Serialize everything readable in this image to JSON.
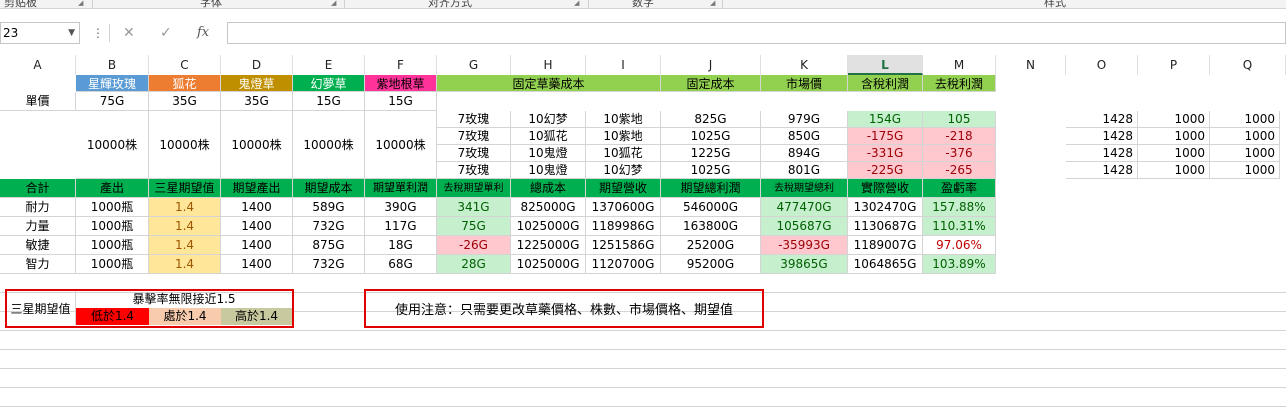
{
  "ribbon": {
    "groups": [
      "剪贴板",
      "字体",
      "对齐方式",
      "数字",
      "样式"
    ]
  },
  "formula_bar": {
    "name_box": "23",
    "fx": "fx",
    "cancel": "✕",
    "enter": "✓",
    "formula": ""
  },
  "columns": [
    "A",
    "B",
    "C",
    "D",
    "E",
    "F",
    "G",
    "H",
    "I",
    "J",
    "K",
    "L",
    "M",
    "N",
    "O",
    "P",
    "Q"
  ],
  "selected_column": "L",
  "rows": {
    "header": [
      "",
      "星輝玫瑰",
      "狐花",
      "鬼燈草",
      "幻夢草",
      "紫地根草",
      "固定草藥成本",
      "",
      "",
      "固定成本",
      "市場價",
      "含稅利潤",
      "去稅利潤"
    ],
    "unit_price": [
      "單價",
      "75G",
      "35G",
      "35G",
      "15G",
      "15G"
    ],
    "stock": "10000株",
    "recipes": [
      {
        "g": "7玫瑰",
        "h": "10幻梦",
        "i": "10紫地",
        "j": "825G",
        "k": "979G",
        "l": "154G",
        "m": "105",
        "o": "1428",
        "p": "1000",
        "q": "1000"
      },
      {
        "g": "7玫瑰",
        "h": "10狐花",
        "i": "10紫地",
        "j": "1025G",
        "k": "850G",
        "l": "-175G",
        "m": "-218",
        "o": "1428",
        "p": "1000",
        "q": "1000"
      },
      {
        "g": "7玫瑰",
        "h": "10鬼燈",
        "i": "10狐花",
        "j": "1225G",
        "k": "894G",
        "l": "-331G",
        "m": "-376",
        "o": "1428",
        "p": "1000",
        "q": "1000"
      },
      {
        "g": "7玫瑰",
        "h": "10鬼燈",
        "i": "10幻梦",
        "j": "1025G",
        "k": "801G",
        "l": "-225G",
        "m": "-265",
        "o": "1428",
        "p": "1000",
        "q": "1000"
      }
    ],
    "summary_header": [
      "合計",
      "產出",
      "三星期望值",
      "期望產出",
      "期望成本",
      "期望單利潤",
      "去稅期望單利",
      "總成本",
      "期望營收",
      "期望總利潤",
      "去稅期望總利",
      "實際營收",
      "盈虧率"
    ],
    "stats": [
      [
        "耐力",
        "1000瓶",
        "1.4",
        "1400",
        "589G",
        "390G",
        "341G",
        "825000G",
        "1370600G",
        "546000G",
        "477470G",
        "1302470G",
        "157.88%"
      ],
      [
        "力量",
        "1000瓶",
        "1.4",
        "1400",
        "732G",
        "117G",
        "75G",
        "1025000G",
        "1189986G",
        "163800G",
        "105687G",
        "1130687G",
        "110.31%"
      ],
      [
        "敏捷",
        "1000瓶",
        "1.4",
        "1400",
        "875G",
        "18G",
        "-26G",
        "1225000G",
        "1251586G",
        "25200G",
        "-35993G",
        "1189007G",
        "97.06%"
      ],
      [
        "智力",
        "1000瓶",
        "1.4",
        "1400",
        "732G",
        "68G",
        "28G",
        "1025000G",
        "1120700G",
        "95200G",
        "39865G",
        "1064865G",
        "103.89%"
      ]
    ]
  },
  "legend_box": {
    "label": "三星期望值",
    "title": "暴擊率無限接近1.5",
    "low": "低於1.4",
    "equal": "處於1.4",
    "high": "高於1.4"
  },
  "note": "使用注意：只需要更改草藥價格、株數、市場價格、期望值",
  "colors": {
    "rose": "#5b9bd5",
    "fox": "#ed7d31",
    "ghost": "#bf8f00",
    "dream": "#00b050",
    "purple": "#ff3399",
    "header_green": "#92d050",
    "summary_green": "#00b050",
    "pos_fill": "#c6efce",
    "pos_text": "#006100",
    "neg_fill": "#ffc7ce",
    "neg_text": "#9c0006",
    "yellow_fill": "#ffe699",
    "red_fill": "#ff0000",
    "orange_fill": "#f8cbad",
    "tan_fill": "#c9c9a0",
    "accent": "#217346"
  }
}
